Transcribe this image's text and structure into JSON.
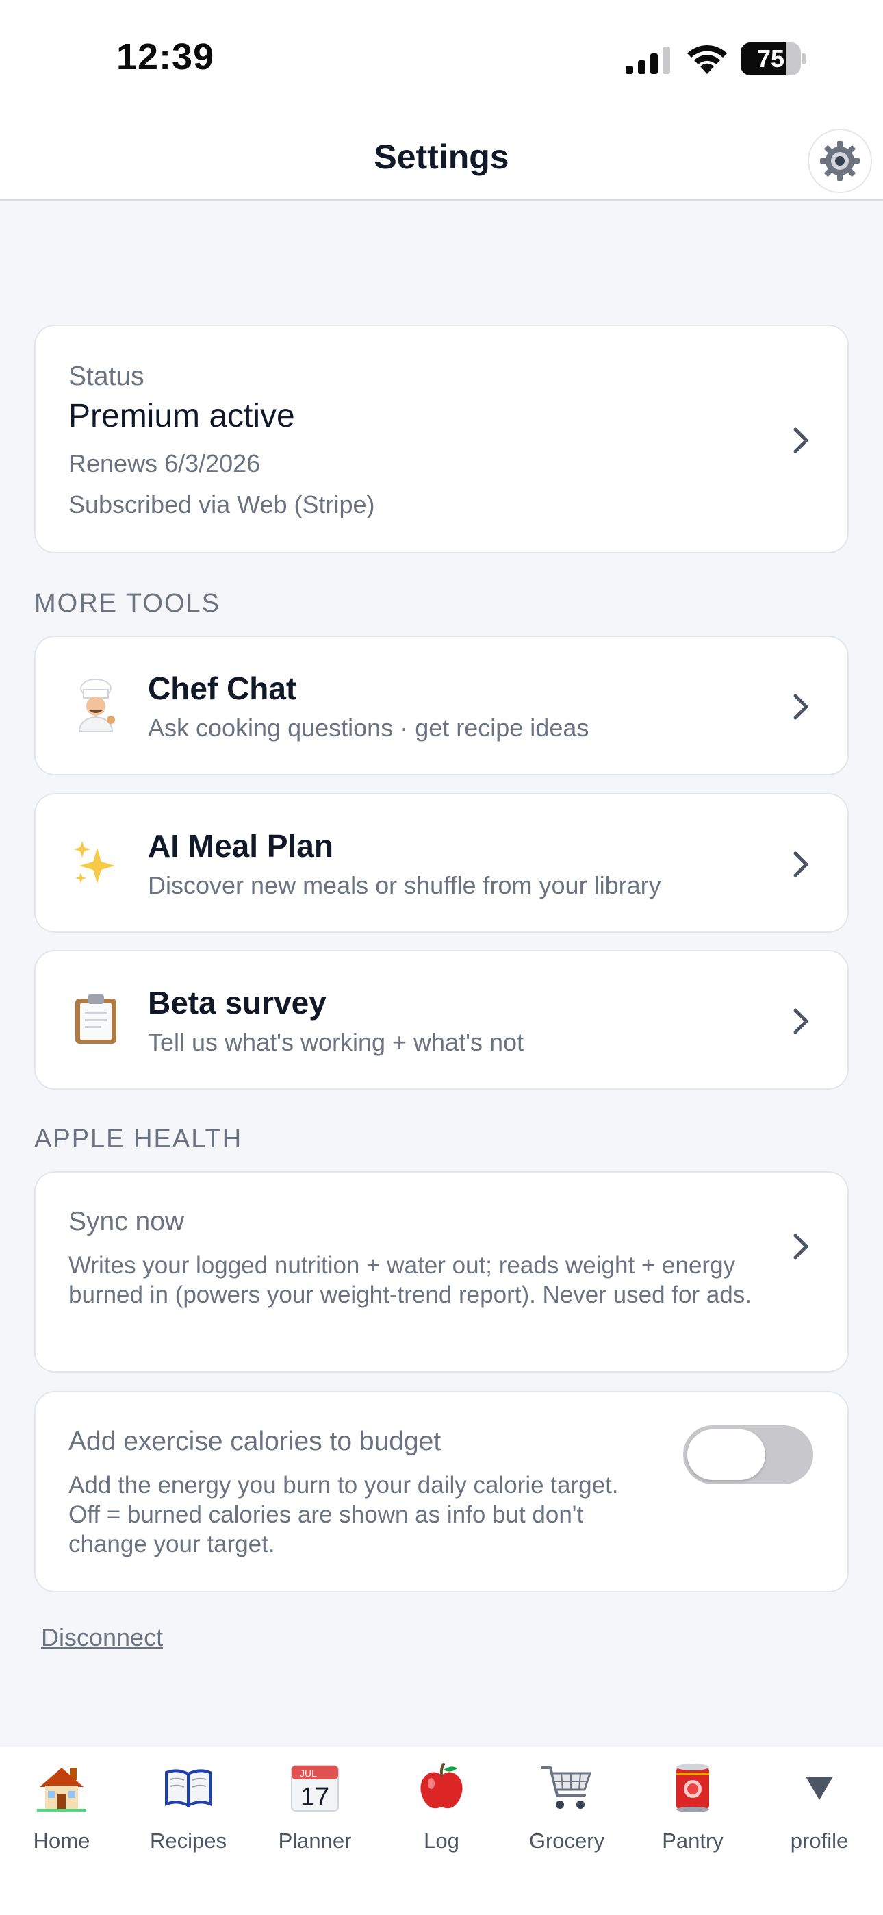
{
  "status_bar": {
    "time": "12:39",
    "battery_percent": "75",
    "battery_level": 0.75
  },
  "header": {
    "title": "Settings",
    "gear_icon": "gear-icon"
  },
  "status_card": {
    "label": "Status",
    "value": "Premium active",
    "renews": "Renews 6/3/2026",
    "subscribed_via": "Subscribed via Web (Stripe)"
  },
  "sections": {
    "more_tools": "MORE TOOLS",
    "apple_health": "APPLE HEALTH"
  },
  "tools": [
    {
      "icon": "chef-icon",
      "title": "Chef Chat",
      "subtitle": "Ask cooking questions · get recipe ideas"
    },
    {
      "icon": "sparkles-icon",
      "title": "AI Meal Plan",
      "subtitle": "Discover new meals or shuffle from your library"
    },
    {
      "icon": "clipboard-icon",
      "title": "Beta survey",
      "subtitle": "Tell us what's working + what's not"
    }
  ],
  "health": {
    "sync_title": "Sync now",
    "sync_description": "Writes your logged nutrition + water out; reads weight + energy burned in (powers your weight-trend report). Never used for ads.",
    "exercise_title": "Add exercise calories to budget",
    "exercise_description": "Add the energy you burn to your daily calorie target. Off = burned calories are shown as info but don't change your target.",
    "exercise_toggle_on": false
  },
  "disconnect_label": "Disconnect",
  "tabs": [
    {
      "icon": "house-icon",
      "label": "Home"
    },
    {
      "icon": "book-icon",
      "label": "Recipes"
    },
    {
      "icon": "calendar-icon",
      "label": "Planner",
      "calendar_month": "JUL",
      "calendar_day": "17"
    },
    {
      "icon": "apple-icon",
      "label": "Log"
    },
    {
      "icon": "cart-icon",
      "label": "Grocery"
    },
    {
      "icon": "can-icon",
      "label": "Pantry"
    },
    {
      "icon": "triangle-down-icon",
      "label": "profile"
    }
  ],
  "colors": {
    "background": "#f4f6f9",
    "card": "#ffffff",
    "text_primary": "#111827",
    "text_secondary": "#6b7280",
    "toggle_off": "#c8c8cc"
  }
}
